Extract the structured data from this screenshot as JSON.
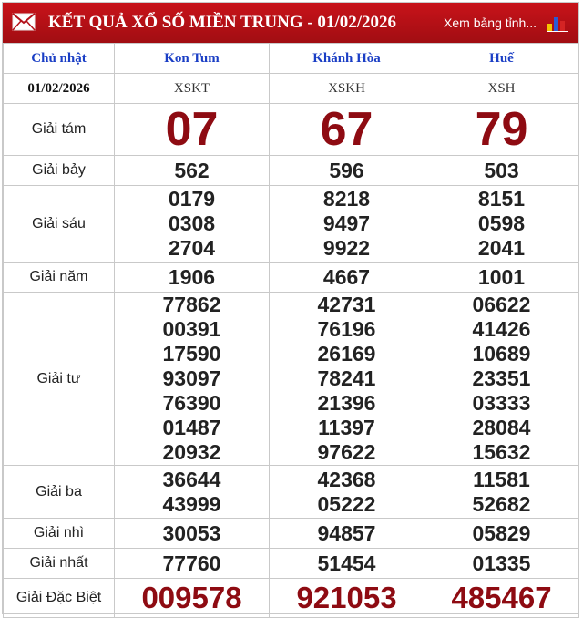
{
  "header": {
    "title": "KẾT QUẢ XỔ SỐ MIỀN TRUNG - 01/02/2026",
    "more_link": "Xem bảng tỉnh...",
    "colors": {
      "header_bg": "#b3111a",
      "special_number": "#8e0b12",
      "province_link": "#1a3ec5"
    }
  },
  "columns": {
    "label": "Chủ nhật",
    "provinces": [
      "Kon Tum",
      "Khánh Hòa",
      "Huế"
    ]
  },
  "date_row": {
    "date": "01/02/2026",
    "codes": [
      "XSKT",
      "XSKH",
      "XSH"
    ]
  },
  "prizes": [
    {
      "name": "Giải tám",
      "results": [
        [
          "07"
        ],
        [
          "67"
        ],
        [
          "79"
        ]
      ]
    },
    {
      "name": "Giải bảy",
      "results": [
        [
          "562"
        ],
        [
          "596"
        ],
        [
          "503"
        ]
      ]
    },
    {
      "name": "Giải sáu",
      "results": [
        [
          "0179",
          "0308",
          "2704"
        ],
        [
          "8218",
          "9497",
          "9922"
        ],
        [
          "8151",
          "0598",
          "2041"
        ]
      ]
    },
    {
      "name": "Giải năm",
      "results": [
        [
          "1906"
        ],
        [
          "4667"
        ],
        [
          "1001"
        ]
      ]
    },
    {
      "name": "Giải tư",
      "results": [
        [
          "77862",
          "00391",
          "17590",
          "93097",
          "76390",
          "01487",
          "20932"
        ],
        [
          "42731",
          "76196",
          "26169",
          "78241",
          "21396",
          "11397",
          "97622"
        ],
        [
          "06622",
          "41426",
          "10689",
          "23351",
          "03333",
          "28084",
          "15632"
        ]
      ]
    },
    {
      "name": "Giải ba",
      "results": [
        [
          "36644",
          "43999"
        ],
        [
          "42368",
          "05222"
        ],
        [
          "11581",
          "52682"
        ]
      ]
    },
    {
      "name": "Giải nhì",
      "results": [
        [
          "30053"
        ],
        [
          "94857"
        ],
        [
          "05829"
        ]
      ]
    },
    {
      "name": "Giải nhất",
      "results": [
        [
          "77760"
        ],
        [
          "51454"
        ],
        [
          "01335"
        ]
      ]
    },
    {
      "name": "Giải Đặc Biệt",
      "results": [
        [
          "009578"
        ],
        [
          "921053"
        ],
        [
          "485467"
        ]
      ]
    }
  ]
}
